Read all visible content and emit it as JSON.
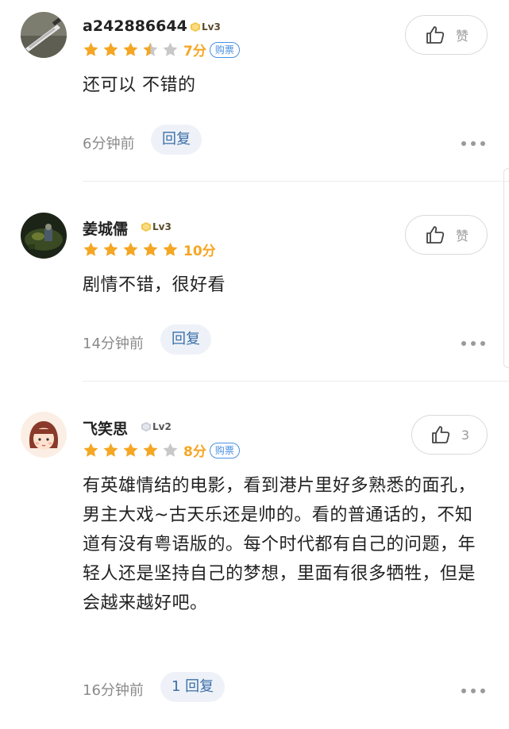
{
  "colors": {
    "star_filled": "#f5a623",
    "star_empty": "#c8c8c8",
    "score": "#f5a623",
    "ticket": "#4a90e2",
    "reply_bg": "#eef2f8",
    "reply_text": "#3b6fa8"
  },
  "comments": [
    {
      "username": "a242886644",
      "level": "Lv3",
      "rating_stars": 3.5,
      "score": "7分",
      "ticket_badge": "购票",
      "like_label": "赞",
      "text": "还可以 不错的",
      "time": "6分钟前",
      "reply_label": "回复",
      "avatar_icon": "knife-avatar-icon"
    },
    {
      "username": "姜城儒",
      "level": "Lv3",
      "rating_stars": 5,
      "score": "10分",
      "like_label": "赞",
      "text": "剧情不错，很好看",
      "time": "14分钟前",
      "reply_label": "回复",
      "avatar_icon": "game-scene-avatar-icon"
    },
    {
      "username": "飞笑思",
      "level": "Lv2",
      "rating_stars": 4,
      "score": "8分",
      "ticket_badge": "购票",
      "like_label": "3",
      "text": "有英雄情结的电影，看到港片里好多熟悉的面孔，男主大戏~古天乐还是帅的。看的普通话的，不知道有没有粤语版的。每个时代都有自己的问题，年轻人还是坚持自己的梦想，里面有很多牺牲，但是会越来越好吧。",
      "time": "16分钟前",
      "reply_label": "1 回复",
      "avatar_icon": "cartoon-girl-avatar-icon"
    }
  ]
}
